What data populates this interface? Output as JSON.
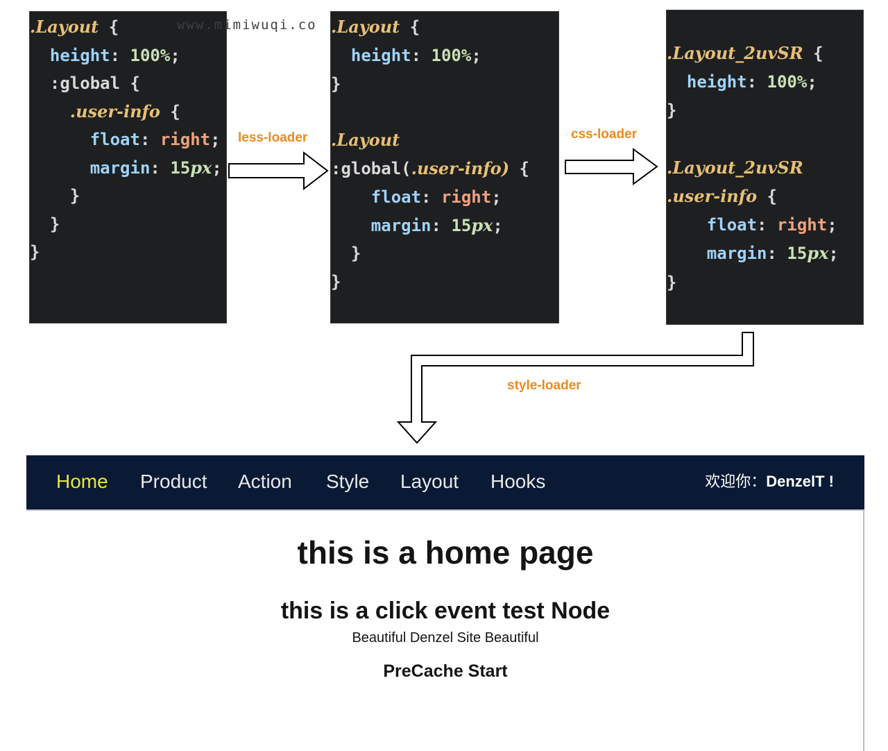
{
  "watermark": "www.mimiwuqi.co",
  "panels": [
    {
      "name": "less-source",
      "lines": [
        [
          [
            ".Layout",
            "sel"
          ],
          [
            " ",
            "plain"
          ],
          [
            "{",
            "brace"
          ]
        ],
        [
          [
            "  ",
            "plain"
          ],
          [
            "height",
            "prop"
          ],
          [
            ": ",
            "plain"
          ],
          [
            "100%",
            "val"
          ],
          [
            ";",
            "plain"
          ]
        ],
        [
          [
            "  ",
            "plain"
          ],
          [
            ":global",
            "plain"
          ],
          [
            " ",
            "plain"
          ],
          [
            "{",
            "brace"
          ]
        ],
        [
          [
            "    ",
            "plain"
          ],
          [
            ".user-info",
            "sel"
          ],
          [
            " ",
            "plain"
          ],
          [
            "{",
            "brace"
          ]
        ],
        [
          [
            "      ",
            "plain"
          ],
          [
            "float",
            "prop"
          ],
          [
            ": ",
            "plain"
          ],
          [
            "right",
            "kw"
          ],
          [
            ";",
            "plain"
          ]
        ],
        [
          [
            "      ",
            "plain"
          ],
          [
            "margin",
            "prop"
          ],
          [
            ": ",
            "plain"
          ],
          [
            "15",
            "val"
          ],
          [
            "px",
            "unit"
          ],
          [
            ";",
            "plain"
          ]
        ],
        [
          [
            "    ",
            "plain"
          ],
          [
            "}",
            "brace"
          ]
        ],
        [
          [
            "  ",
            "plain"
          ],
          [
            "}",
            "brace"
          ]
        ],
        [
          [
            "}",
            "brace"
          ]
        ]
      ]
    },
    {
      "name": "css-intermediate",
      "lines": [
        [
          [
            ".Layout",
            "sel"
          ],
          [
            " ",
            "plain"
          ],
          [
            "{",
            "brace"
          ]
        ],
        [
          [
            "  ",
            "plain"
          ],
          [
            "height",
            "prop"
          ],
          [
            ": ",
            "plain"
          ],
          [
            "100%",
            "val"
          ],
          [
            ";",
            "plain"
          ]
        ],
        [
          [
            "}",
            "brace"
          ]
        ],
        [],
        [
          [
            ".Layout",
            "sel"
          ]
        ],
        [
          [
            ":global(",
            "plain"
          ],
          [
            ".user-info",
            "sel"
          ],
          [
            ")",
            "sel"
          ],
          [
            " ",
            "plain"
          ],
          [
            "{",
            "brace"
          ]
        ],
        [
          [
            "    ",
            "plain"
          ],
          [
            "float",
            "prop"
          ],
          [
            ": ",
            "plain"
          ],
          [
            "right",
            "kw"
          ],
          [
            ";",
            "plain"
          ]
        ],
        [
          [
            "    ",
            "plain"
          ],
          [
            "margin",
            "prop"
          ],
          [
            ": ",
            "plain"
          ],
          [
            "15",
            "val"
          ],
          [
            "px",
            "unit"
          ],
          [
            ";",
            "plain"
          ]
        ],
        [
          [
            "  ",
            "plain"
          ],
          [
            "}",
            "brace"
          ]
        ],
        [
          [
            "}",
            "brace"
          ]
        ]
      ]
    },
    {
      "name": "css-module-output",
      "lines": [
        [
          [
            ".Layout_2uvSR",
            "sel"
          ],
          [
            " ",
            "plain"
          ],
          [
            "{",
            "brace"
          ]
        ],
        [
          [
            "  ",
            "plain"
          ],
          [
            "height",
            "prop"
          ],
          [
            ": ",
            "plain"
          ],
          [
            "100%",
            "val"
          ],
          [
            ";",
            "plain"
          ]
        ],
        [
          [
            "}",
            "brace"
          ]
        ],
        [],
        [
          [
            ".Layout_2uvSR",
            "sel"
          ]
        ],
        [
          [
            ".user-info",
            "sel"
          ],
          [
            " ",
            "plain"
          ],
          [
            "{",
            "brace"
          ]
        ],
        [
          [
            "    ",
            "plain"
          ],
          [
            "float",
            "prop"
          ],
          [
            ": ",
            "plain"
          ],
          [
            "right",
            "kw"
          ],
          [
            ";",
            "plain"
          ]
        ],
        [
          [
            "    ",
            "plain"
          ],
          [
            "margin",
            "prop"
          ],
          [
            ": ",
            "plain"
          ],
          [
            "15",
            "val"
          ],
          [
            "px",
            "unit"
          ],
          [
            ";",
            "plain"
          ]
        ],
        [
          [
            "}",
            "brace"
          ]
        ]
      ]
    }
  ],
  "labels": {
    "less_loader": "less-loader",
    "css_loader": "css-loader",
    "style_loader": "style-loader"
  },
  "colors": {
    "label": "#ec8a1c",
    "code_bg": "#1e1f21",
    "navbar_bg": "#0a1a34",
    "nav_active": "#e8e53a"
  },
  "navbar": {
    "items": [
      "Home",
      "Product",
      "Action",
      "Style",
      "Layout",
      "Hooks"
    ],
    "active_item": "Home",
    "welcome_prefix": "欢迎你：",
    "username": "DenzelT !"
  },
  "content": {
    "title": "this is a home page",
    "subtitle": "this is a click event test Node",
    "tagline": "Beautiful Denzel Site Beautiful",
    "status": "PreCache Start"
  }
}
